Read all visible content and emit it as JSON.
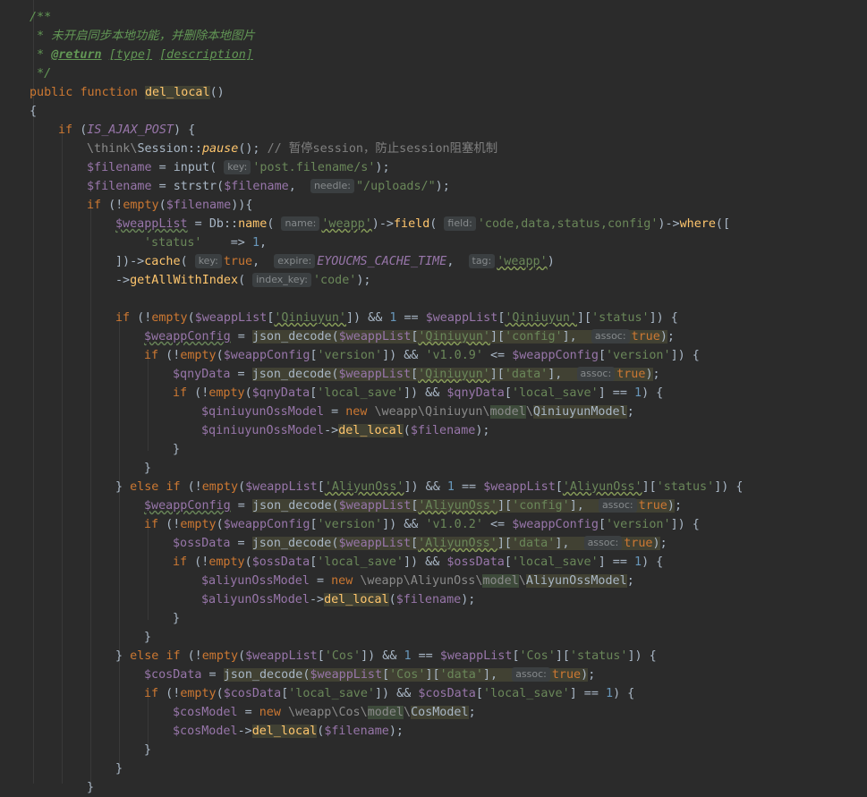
{
  "doc": {
    "open": "/**",
    "desc": " * 未开启同步本地功能，并删除本地图片",
    "ret_tag": "@return",
    "ret_type": "[type]",
    "ret_desc": "[description]",
    "close": " */"
  },
  "kw": {
    "public": "public",
    "function": "function",
    "if": "if",
    "else": "else",
    "new": "new"
  },
  "fn": {
    "del_local": "del_local",
    "pause": "pause",
    "empty": "empty",
    "name": "name",
    "field": "field",
    "where": "where",
    "cache": "cache",
    "getAllWithIndex": "getAllWithIndex",
    "json_decode": "json_decode",
    "input": "input",
    "strstr": "strstr",
    "Session": "Session",
    "Db": "Db"
  },
  "var": {
    "filename": "$filename",
    "weappList": "$weappList",
    "weappConfig": "$weappConfig",
    "qnyData": "$qnyData",
    "qiniuyunOssModel": "$qiniuyunOssModel",
    "ossData": "$ossData",
    "aliyunOssModel": "$aliyunOssModel",
    "cosData": "$cosData",
    "cosModel": "$cosModel"
  },
  "const": {
    "IS_AJAX_POST": "IS_AJAX_POST",
    "EYOUCMS_CACHE_TIME": "EYOUCMS_CACHE_TIME",
    "true": "true"
  },
  "num": {
    "one": "1"
  },
  "hint": {
    "key": "key:",
    "needle": "needle:",
    "name": "name:",
    "field": "field:",
    "key2": "key:",
    "expire": "expire:",
    "tag": "tag:",
    "index_key": "index_key:",
    "assoc": "assoc:"
  },
  "str": {
    "post_filename": "'post.filename/s'",
    "uploads": "\"/uploads/\"",
    "weapp": "'weapp'",
    "fields": "'code,data,status,config'",
    "status": "'status'",
    "code": "'code'",
    "Qiniuyun": "'Qiniuyun'",
    "config": "'config'",
    "version": "'version'",
    "v109": "'v1.0.9'",
    "data": "'data'",
    "local_save": "'local_save'",
    "AliyunOss": "'AliyunOss'",
    "v102": "'v1.0.2'",
    "Cos": "'Cos'"
  },
  "text": {
    "think": "\\think\\",
    "comment": "// 暂停session，防止session阻塞机制",
    "ns_weapp": "\\weapp\\",
    "ns_Qiniuyun": "Qiniuyun\\",
    "model": "model",
    "QiniuyunModel": "QiniuyunModel",
    "ns_AliyunOss": "AliyunOss\\",
    "AliyunOssModel": "AliyunOssModel",
    "ns_Cos": "Cos\\",
    "CosModel": "CosModel"
  }
}
